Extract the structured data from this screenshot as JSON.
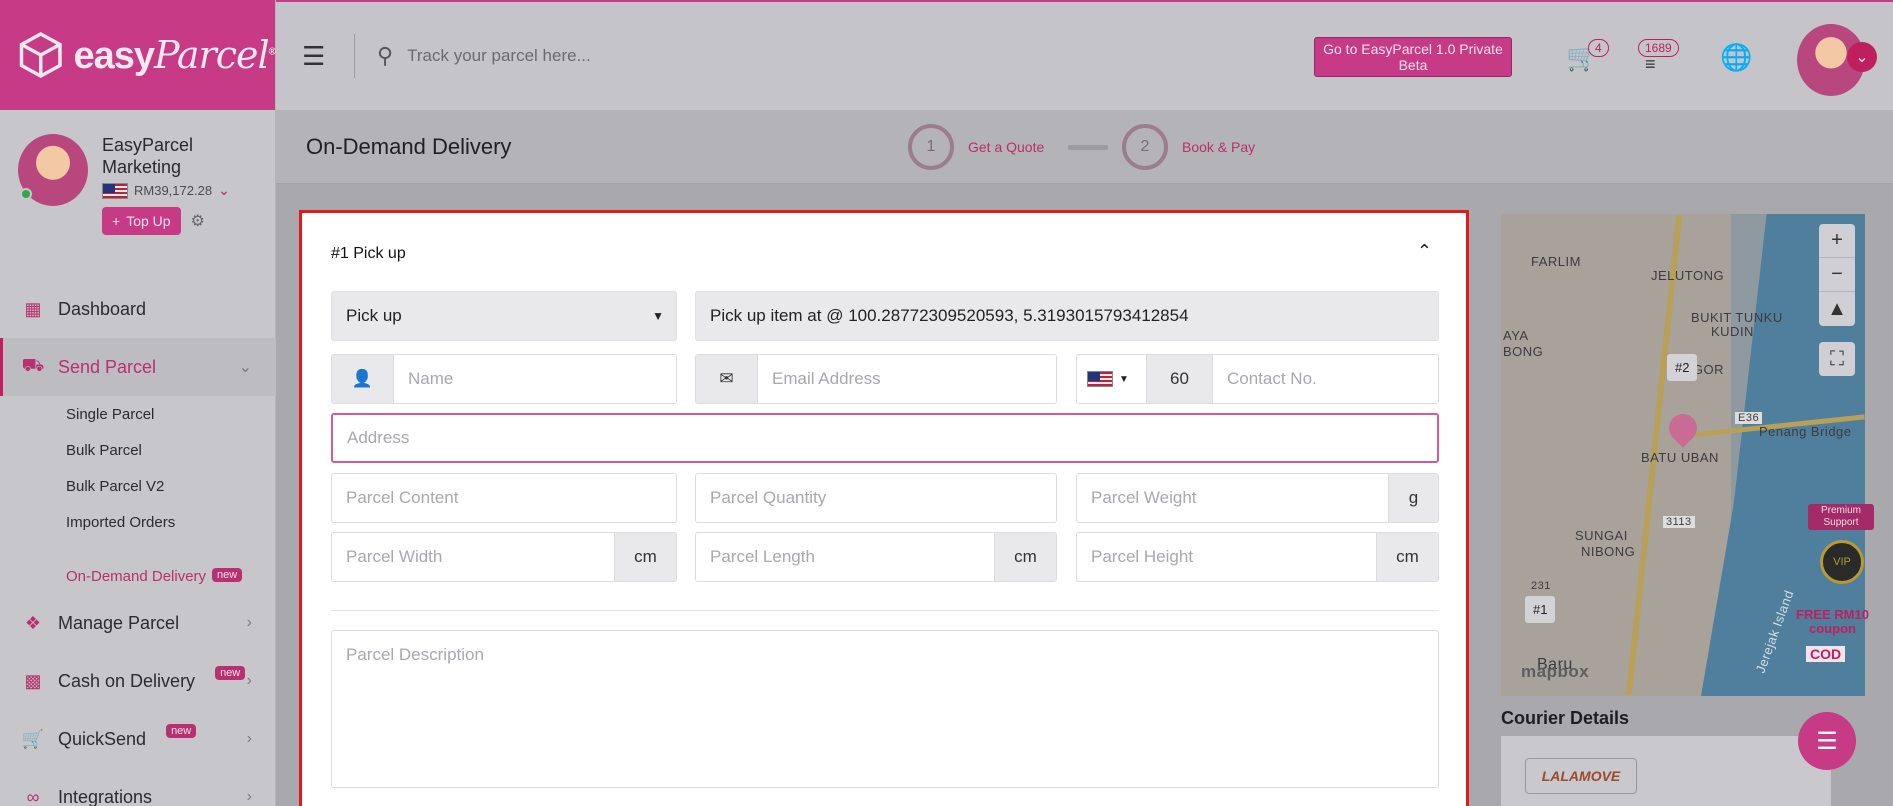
{
  "brand": {
    "logo_word1": "easy",
    "logo_word2": "Parcel",
    "registered": "®"
  },
  "profile": {
    "name": "EasyParcel Marketing",
    "balance": "RM39,172.28",
    "topup_label": "Top Up"
  },
  "nav": {
    "dashboard": "Dashboard",
    "send_parcel": "Send Parcel",
    "send_sub": [
      "Single Parcel",
      "Bulk Parcel",
      "Bulk Parcel V2",
      "Imported Orders"
    ],
    "on_demand": "On-Demand Delivery",
    "manage_parcel": "Manage Parcel",
    "cod": "Cash on Delivery",
    "quicksend": "QuickSend",
    "integrations": "Integrations",
    "new_badge": "new"
  },
  "header": {
    "search_placeholder": "Track your parcel here...",
    "beta_button": "Go to EasyParcel 1.0 Private Beta",
    "cart_count": "4",
    "coin_count": "1689"
  },
  "page": {
    "title": "On-Demand Delivery",
    "steps": [
      {
        "num": "1",
        "label": "Get a Quote"
      },
      {
        "num": "2",
        "label": "Book & Pay"
      }
    ]
  },
  "form": {
    "section_title": "#1 Pick up",
    "type_select": "Pick up",
    "pickup_location": "Pick up item at @ 100.28772309520593, 5.3193015793412854",
    "name_ph": "Name",
    "email_ph": "Email Address",
    "dial_code": "60",
    "contact_ph": "Contact No.",
    "address_ph": "Address",
    "content_ph": "Parcel Content",
    "quantity_ph": "Parcel Quantity",
    "weight_ph": "Parcel Weight",
    "weight_unit": "g",
    "width_ph": "Parcel Width",
    "length_ph": "Parcel Length",
    "height_ph": "Parcel Height",
    "dim_unit": "cm",
    "description_ph": "Parcel Description"
  },
  "map": {
    "labels": [
      "FARLIM",
      "JELUTONG",
      "BUKIT TUNKU",
      "KUDIN",
      "AYA",
      "BONG",
      "UGOR",
      "BATU UBAN",
      "Penang Bridge",
      "E36",
      "SUNGAI",
      "NIBONG",
      "3113",
      "231",
      "Baru",
      "mapbox",
      "Jerejak Island"
    ],
    "tag_drop": "#2",
    "tag_pick": "#1"
  },
  "widgets": {
    "premium": "Premium Support",
    "vip": "VIP",
    "free": "FREE RM10",
    "coupon": "coupon",
    "cod": "COD"
  },
  "courier": {
    "title": "Courier Details",
    "name": "LALAMOVE"
  },
  "colors": {
    "brand": "#c63a86",
    "highlight_border": "#e01b1b"
  }
}
